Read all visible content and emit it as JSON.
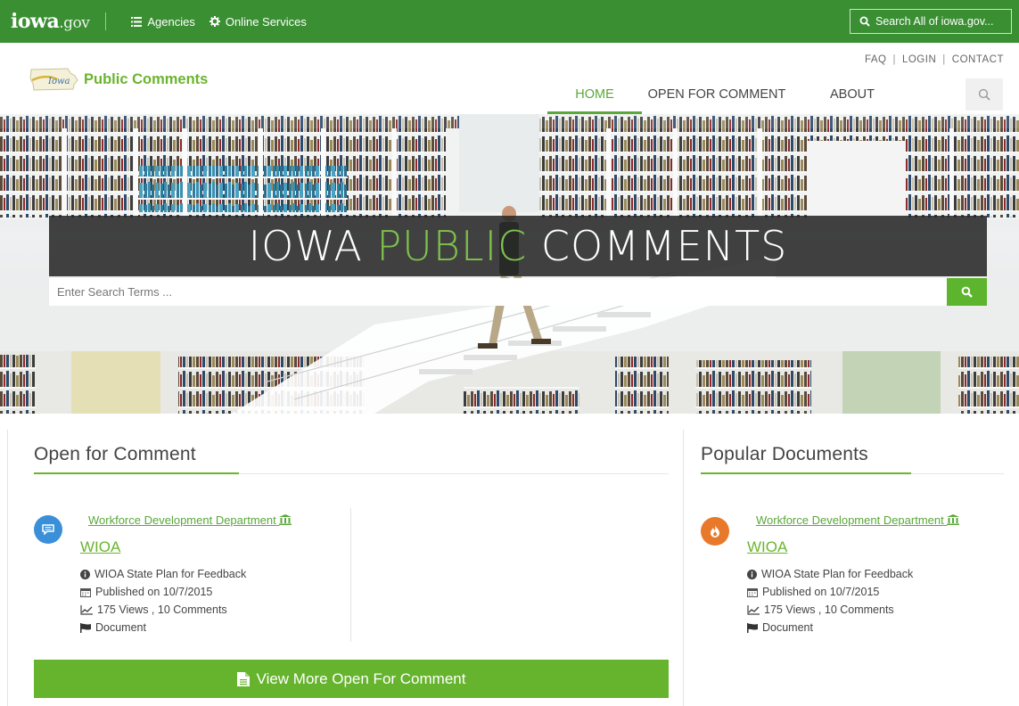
{
  "statebar": {
    "logo_main": "iowa",
    "logo_suffix": ".gov",
    "agencies_label": "Agencies",
    "services_label": "Online Services",
    "search_label": "Search All of iowa.gov..."
  },
  "header": {
    "brand_title": "Public Comments",
    "utility": [
      "FAQ",
      "LOGIN",
      "CONTACT"
    ],
    "nav": {
      "home": "HOME",
      "open": "OPEN FOR COMMENT",
      "about": "ABOUT"
    }
  },
  "hero": {
    "title_part1": "IOWA ",
    "title_part2": "PUBLIC",
    "title_part3": " COMMENTS",
    "search_placeholder": "Enter Search Terms ..."
  },
  "open_section": {
    "title": "Open for Comment",
    "item": {
      "agency": "Workforce Development Department",
      "doc_title": "WIOA",
      "description": "WIOA State Plan for Feedback",
      "published": "Published on 10/7/2015",
      "stats": "175 Views , 10 Comments",
      "type": "Document"
    },
    "cta_label": "View More Open For Comment"
  },
  "popular_section": {
    "title": "Popular Documents",
    "item": {
      "agency": "Workforce Development Department",
      "doc_title": "WIOA",
      "description": "WIOA State Plan for Feedback",
      "published": "Published on 10/7/2015",
      "stats": "175 Views , 10 Comments",
      "type": "Document"
    }
  },
  "colors": {
    "state_green": "#3a8f33",
    "accent_green": "#6ab52e",
    "comment_blue": "#3a8fd9",
    "popular_orange": "#e8792a"
  }
}
